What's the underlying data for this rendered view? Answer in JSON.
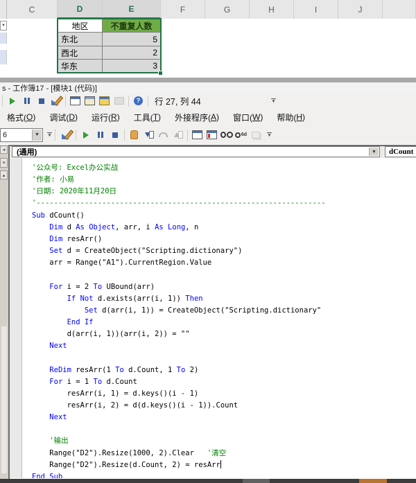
{
  "spreadsheet": {
    "column_headers": [
      "C",
      "D",
      "E",
      "F",
      "G",
      "H",
      "I",
      "J"
    ],
    "selected_columns": [
      "D",
      "E"
    ],
    "table": {
      "header_row": [
        "地区",
        "不重复人数"
      ],
      "rows": [
        {
          "region": "东北",
          "count": "5"
        },
        {
          "region": "西北",
          "count": "2"
        },
        {
          "region": "华东",
          "count": "3"
        }
      ]
    },
    "colors": {
      "table_header_fill": "#6FAC46",
      "selection_green": "#217346",
      "data_cell_fill": "#D9D9D9"
    }
  },
  "vbe": {
    "window_title": "s - 工作簿17 - [模块1 (代码)]",
    "menu_items": [
      "格式(O)",
      "调试(D)",
      "运行(R)",
      "工具(T)",
      "外接程序(A)",
      "窗口(W)",
      "帮助(H)"
    ],
    "standard_toolbar": {
      "caret_position_label": "行 27, 列 44",
      "icons": [
        [
          "run",
          0
        ],
        [
          "break",
          0
        ],
        [
          "reset",
          0
        ],
        [
          "design",
          0
        ],
        [
          "sep",
          0
        ],
        [
          "projexp",
          0
        ],
        [
          "props",
          0
        ],
        [
          "objbrowser",
          0
        ],
        [
          "toolbox",
          1
        ],
        [
          "sep",
          0
        ],
        [
          "help",
          0
        ],
        [
          "sep",
          0
        ]
      ]
    },
    "debug_toolbar": {
      "combo_value": "6",
      "icons": [
        [
          "design",
          0
        ],
        [
          "sep",
          0
        ],
        [
          "run",
          0
        ],
        [
          "break",
          0
        ],
        [
          "reset",
          0
        ],
        [
          "sep",
          0
        ],
        [
          "hand",
          0
        ],
        [
          "stepinto",
          0
        ],
        [
          "stepover",
          1
        ],
        [
          "stepout",
          1
        ],
        [
          "sep",
          0
        ],
        [
          "locals",
          0
        ],
        [
          "immediate",
          0
        ],
        [
          "watch",
          0
        ],
        [
          "quickwatch",
          0
        ],
        [
          "callstack",
          1
        ]
      ]
    },
    "object_dropdown_value": "(通用)",
    "procedure_dropdown_value": "dCount"
  },
  "code": {
    "comment_color": "#008000",
    "keyword_color": "#0000FF",
    "cursor_row": 25,
    "lines": [
      [
        [
          "c",
          "'公众号: Excel办公实战"
        ]
      ],
      [
        [
          "c",
          "'作者: 小易"
        ]
      ],
      [
        [
          "c",
          "'日期: 2020年11月20日"
        ]
      ],
      [
        [
          "c",
          "'------------------------------------------------------------------"
        ]
      ],
      [
        [
          "k",
          "Sub"
        ],
        [
          "n",
          " dCount()"
        ]
      ],
      [
        [
          "n",
          "    "
        ],
        [
          "k",
          "Dim"
        ],
        [
          "n",
          " d "
        ],
        [
          "k",
          "As"
        ],
        [
          "n",
          " "
        ],
        [
          "k",
          "Object"
        ],
        [
          "n",
          ", arr, i "
        ],
        [
          "k",
          "As"
        ],
        [
          "n",
          " "
        ],
        [
          "k",
          "Long"
        ],
        [
          "n",
          ", n"
        ]
      ],
      [
        [
          "n",
          "    "
        ],
        [
          "k",
          "Dim"
        ],
        [
          "n",
          " resArr()"
        ]
      ],
      [
        [
          "n",
          "    "
        ],
        [
          "k",
          "Set"
        ],
        [
          "n",
          " d = CreateObject(\"Scripting.dictionary\")"
        ]
      ],
      [
        [
          "n",
          "    arr = Range(\"A1\").CurrentRegion.Value"
        ]
      ],
      [],
      [
        [
          "n",
          "    "
        ],
        [
          "k",
          "For"
        ],
        [
          "n",
          " i = 2 "
        ],
        [
          "k",
          "To"
        ],
        [
          "n",
          " UBound(arr)"
        ]
      ],
      [
        [
          "n",
          "        "
        ],
        [
          "k",
          "If"
        ],
        [
          "n",
          " "
        ],
        [
          "k",
          "Not"
        ],
        [
          "n",
          " d.exists(arr(i, 1)) "
        ],
        [
          "k",
          "Then"
        ]
      ],
      [
        [
          "n",
          "            "
        ],
        [
          "k",
          "Set"
        ],
        [
          "n",
          " d(arr(i, 1)) = CreateObject(\"Scripting.dictionary\""
        ]
      ],
      [
        [
          "n",
          "        "
        ],
        [
          "k",
          "End If"
        ]
      ],
      [
        [
          "n",
          "        d(arr(i, 1))(arr(i, 2)) = \"\""
        ]
      ],
      [
        [
          "n",
          "    "
        ],
        [
          "k",
          "Next"
        ]
      ],
      [],
      [
        [
          "n",
          "    "
        ],
        [
          "k",
          "ReDim"
        ],
        [
          "n",
          " resArr(1 "
        ],
        [
          "k",
          "To"
        ],
        [
          "n",
          " d.Count, 1 "
        ],
        [
          "k",
          "To"
        ],
        [
          "n",
          " 2)"
        ]
      ],
      [
        [
          "n",
          "    "
        ],
        [
          "k",
          "For"
        ],
        [
          "n",
          " i = 1 "
        ],
        [
          "k",
          "To"
        ],
        [
          "n",
          " d.Count"
        ]
      ],
      [
        [
          "n",
          "        resArr(i, 1) = d.keys()(i - 1)"
        ]
      ],
      [
        [
          "n",
          "        resArr(i, 2) = d(d.keys()(i - 1)).Count"
        ]
      ],
      [
        [
          "n",
          "    "
        ],
        [
          "k",
          "Next"
        ]
      ],
      [],
      [
        [
          "n",
          "    "
        ],
        [
          "c",
          "'输出"
        ]
      ],
      [
        [
          "n",
          "    Range(\"D2\").Resize(1000, 2).Clear   "
        ],
        [
          "c",
          "'清空"
        ]
      ],
      [
        [
          "n",
          "    Range(\"D2\").Resize(d.Count, 2) = resArr"
        ]
      ],
      [
        [
          "k",
          "End Sub"
        ]
      ]
    ]
  }
}
